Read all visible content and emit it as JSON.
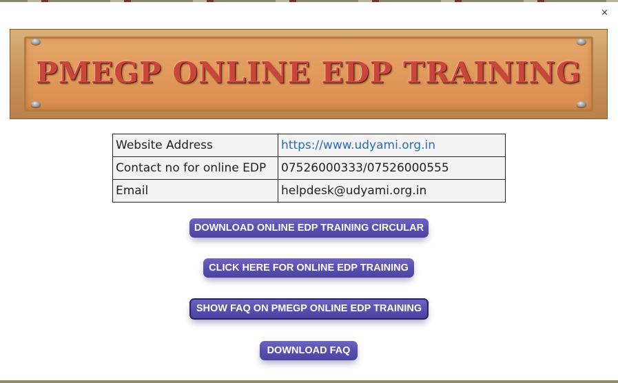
{
  "dialog": {
    "close_label": "×"
  },
  "banner": {
    "title": "PMEGP ONLINE EDP TRAINING"
  },
  "info": {
    "rows": [
      {
        "label": "Website Address",
        "value": "https://www.udyami.org.in"
      },
      {
        "label": "Contact no for online EDP",
        "value": "07526000333/07526000555"
      },
      {
        "label": "Email",
        "value": "helpdesk@udyami.org.in"
      }
    ]
  },
  "buttons": {
    "download_circular": "DOWNLOAD ONLINE EDP TRAINING CIRCULAR",
    "online_training": "CLICK HERE FOR ONLINE EDP TRAINING",
    "show_faq": "SHOW FAQ ON PMEGP ONLINE EDP TRAINING",
    "download_faq": "DOWNLOAD FAQ"
  },
  "colors": {
    "button": "#5a4fb0",
    "link": "#2a6db0",
    "banner_text": "#c8463a"
  }
}
